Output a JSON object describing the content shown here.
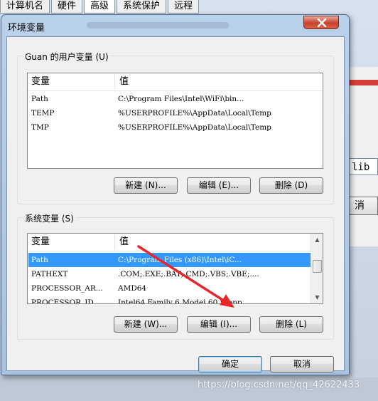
{
  "background_window": {
    "tabs": [
      "计算机名",
      "硬件",
      "高级",
      "系统保护",
      "远程"
    ],
    "active_tab_index": 2,
    "partial_field_text": "lib",
    "partial_button_text": "消"
  },
  "dialog": {
    "title": "环境变量",
    "user_vars": {
      "group_label": "Guan 的用户变量 (U)",
      "col_name": "变量",
      "col_value": "值",
      "rows": [
        {
          "name": "Path",
          "value": "C:\\Program Files\\Intel\\WiFi\\bin..."
        },
        {
          "name": "TEMP",
          "value": "%USERPROFILE%\\AppData\\Local\\Temp"
        },
        {
          "name": "TMP",
          "value": "%USERPROFILE%\\AppData\\Local\\Temp"
        }
      ],
      "new_label": "新建 (N)...",
      "edit_label": "编辑 (E)...",
      "delete_label": "删除 (D)"
    },
    "system_vars": {
      "group_label": "系统变量 (S)",
      "col_name": "变量",
      "col_value": "值",
      "rows": [
        {
          "name": "Path",
          "value": "C:\\Program Files (x86)\\Intel\\iC...",
          "selected": true
        },
        {
          "name": "PATHEXT",
          "value": ".COM;.EXE;.BAT;.CMD;.VBS;.VBE;....",
          "selected": false
        },
        {
          "name": "PROCESSOR_AR...",
          "value": "AMD64",
          "selected": false
        },
        {
          "name": "PROCESSOR_ID...",
          "value": "Intel64 Family 6 Model 60 Stepp...",
          "selected": false
        }
      ],
      "new_label": "新建 (W)...",
      "edit_label": "编辑 (I)...",
      "delete_label": "删除 (L)"
    },
    "ok_label": "确定",
    "cancel_label": "取消"
  },
  "annotation": {
    "arrow_color": "#e8262a"
  },
  "watermark": "https://blog.csdn.net/qq_42622433"
}
